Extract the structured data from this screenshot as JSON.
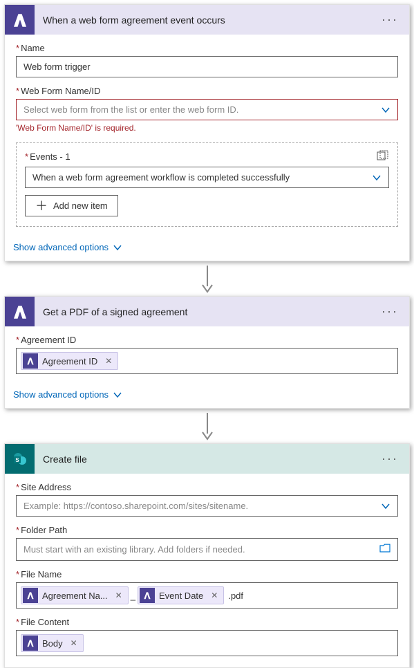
{
  "card1": {
    "title": "When a web form agreement event occurs",
    "name_label": "Name",
    "name_value": "Web form trigger",
    "webform_label": "Web Form Name/ID",
    "webform_placeholder": "Select web form from the list or enter the web form ID.",
    "webform_error": "'Web Form Name/ID' is required.",
    "events_label": "Events - 1",
    "events_value": "When a web form agreement workflow is completed successfully",
    "add_item_label": "Add new item",
    "advanced_label": "Show advanced options"
  },
  "card2": {
    "title": "Get a PDF of a signed agreement",
    "agreement_label": "Agreement ID",
    "agreement_token": "Agreement ID",
    "advanced_label": "Show advanced options"
  },
  "card3": {
    "title": "Create file",
    "site_label": "Site Address",
    "site_placeholder": "Example: https://contoso.sharepoint.com/sites/sitename.",
    "folder_label": "Folder Path",
    "folder_placeholder": "Must start with an existing library. Add folders if needed.",
    "filename_label": "File Name",
    "filename_token1": "Agreement Na...",
    "filename_sep": "_",
    "filename_token2": "Event Date",
    "filename_suffix": ".pdf",
    "filecontent_label": "File Content",
    "filecontent_token": "Body"
  }
}
